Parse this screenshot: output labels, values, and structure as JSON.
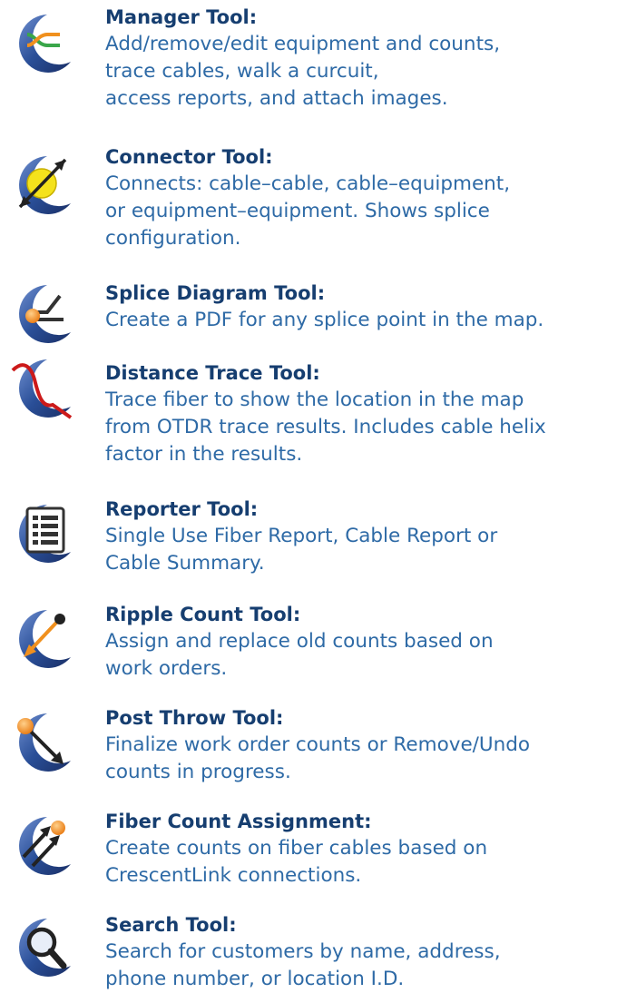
{
  "colors": {
    "title": "#163e70",
    "description": "#2e6aa6",
    "icon_crescent": "#2a4f98",
    "accent_orange": "#f0901e",
    "accent_yellow": "#f4e21c",
    "accent_red": "#cc1a1a",
    "accent_green": "#3aa64a"
  },
  "tools": [
    {
      "icon": "manager-icon",
      "title": "Manager Tool:",
      "lines": [
        "Add/remove/edit equipment and counts,",
        "trace cables,  walk a curcuit,",
        "access reports, and attach images."
      ]
    },
    {
      "icon": "connector-icon",
      "title": "Connector Tool:",
      "lines": [
        "Connects: cable–cable, cable–equipment,",
        "or equipment–equipment. Shows splice",
        "configuration."
      ]
    },
    {
      "icon": "splice-diagram-icon",
      "title": "Splice Diagram Tool:",
      "lines": [
        "Create a PDF for any splice point in the map."
      ]
    },
    {
      "icon": "distance-trace-icon",
      "title": "Distance Trace Tool:",
      "lines": [
        "Trace fiber to show the location in the map",
        "from OTDR trace results. Includes cable helix",
        "factor in the results."
      ]
    },
    {
      "icon": "reporter-icon",
      "title": "Reporter Tool:",
      "lines": [
        "Single Use Fiber Report, Cable Report or",
        "Cable Summary."
      ]
    },
    {
      "icon": "ripple-count-icon",
      "title": "Ripple Count Tool:",
      "lines": [
        "Assign and replace old counts based on",
        "work orders."
      ]
    },
    {
      "icon": "post-throw-icon",
      "title": "Post Throw Tool:",
      "lines": [
        "Finalize work order counts or Remove/Undo",
        "counts in progress."
      ]
    },
    {
      "icon": "fiber-count-assignment-icon",
      "title": "Fiber Count Assignment:",
      "lines": [
        "Create counts on fiber cables based on",
        "CrescentLink connections."
      ]
    },
    {
      "icon": "search-icon",
      "title": "Search Tool:",
      "lines": [
        "Search for customers by name, address,",
        "phone number, or location I.D."
      ]
    }
  ]
}
